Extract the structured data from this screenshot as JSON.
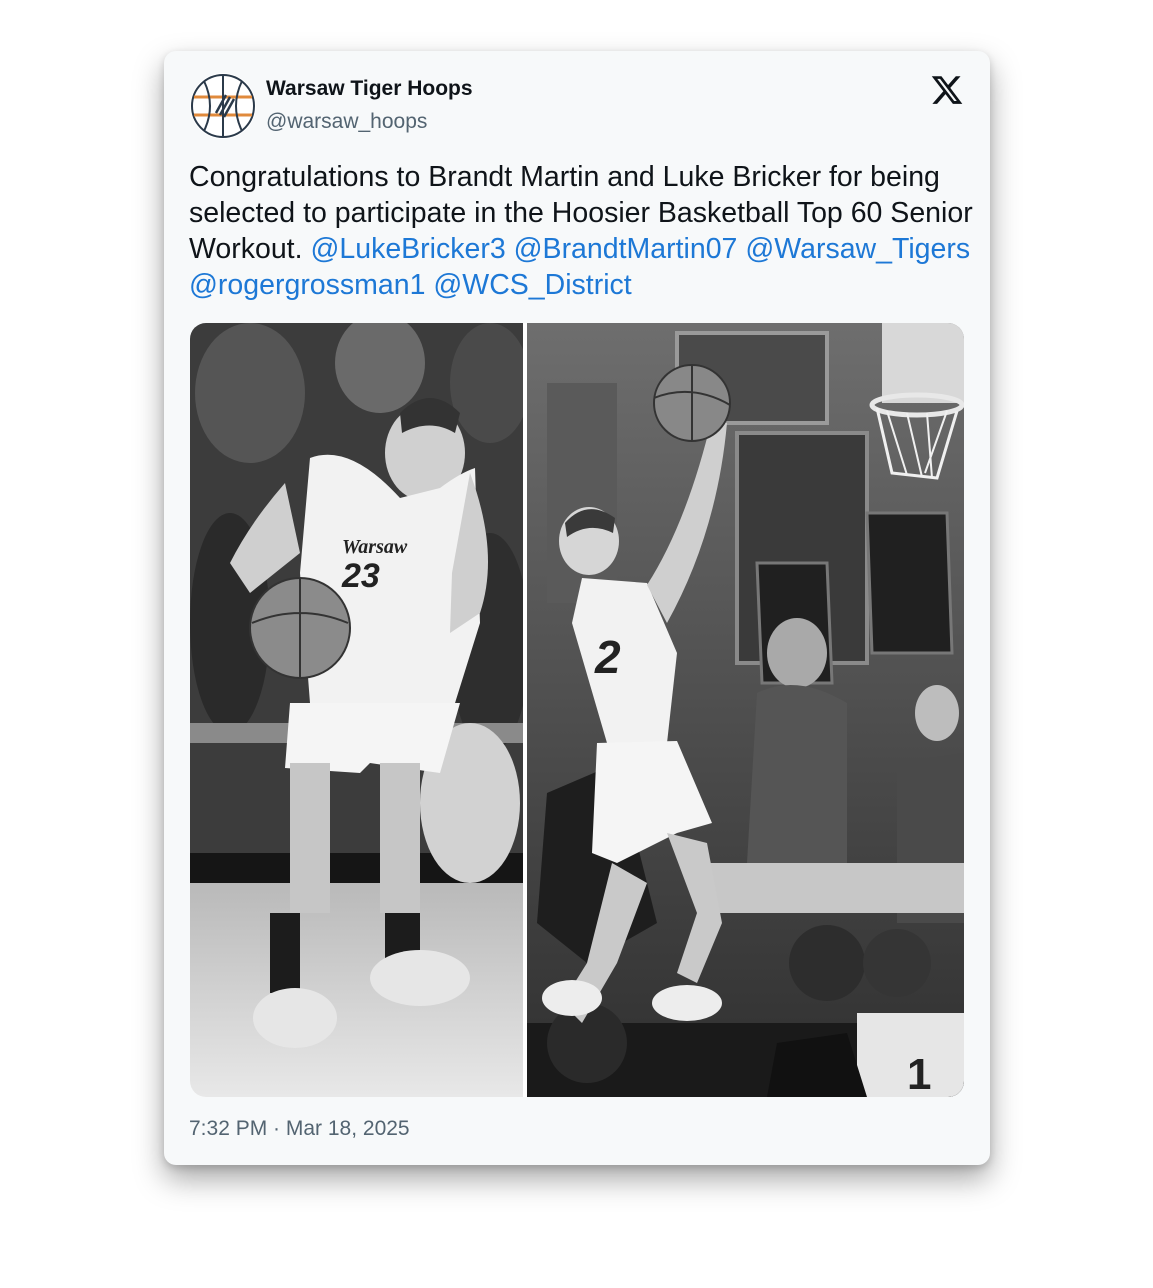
{
  "tweet": {
    "author_name": "Warsaw Tiger Hoops",
    "author_handle": "@warsaw_hoops",
    "text_plain": "Congratulations to Brandt Martin and Luke Bricker for being selected to participate in the Hoosier Basketball Top 60 Senior Workout.",
    "mentions": [
      "@LukeBricker3",
      "@BrandtMartin07",
      "@Warsaw_Tigers",
      "@rogergrossman1",
      "@WCS_District"
    ],
    "timestamp": "7:32 PM · Mar 18, 2025"
  },
  "photos": {
    "left": {
      "jersey_text": "Warsaw",
      "jersey_number": "23"
    },
    "right": {
      "jersey_number": "2",
      "bg_jersey_number": "1"
    }
  },
  "icons": {
    "platform": "x-logo-icon",
    "avatar": "basketball-logo-icon"
  },
  "colors": {
    "link": "#1d78d6",
    "text": "#0f1419",
    "muted": "#536471",
    "card": "#f7f9fa",
    "avatar_orange": "#e08a3c",
    "avatar_dark": "#2b3a4a"
  }
}
